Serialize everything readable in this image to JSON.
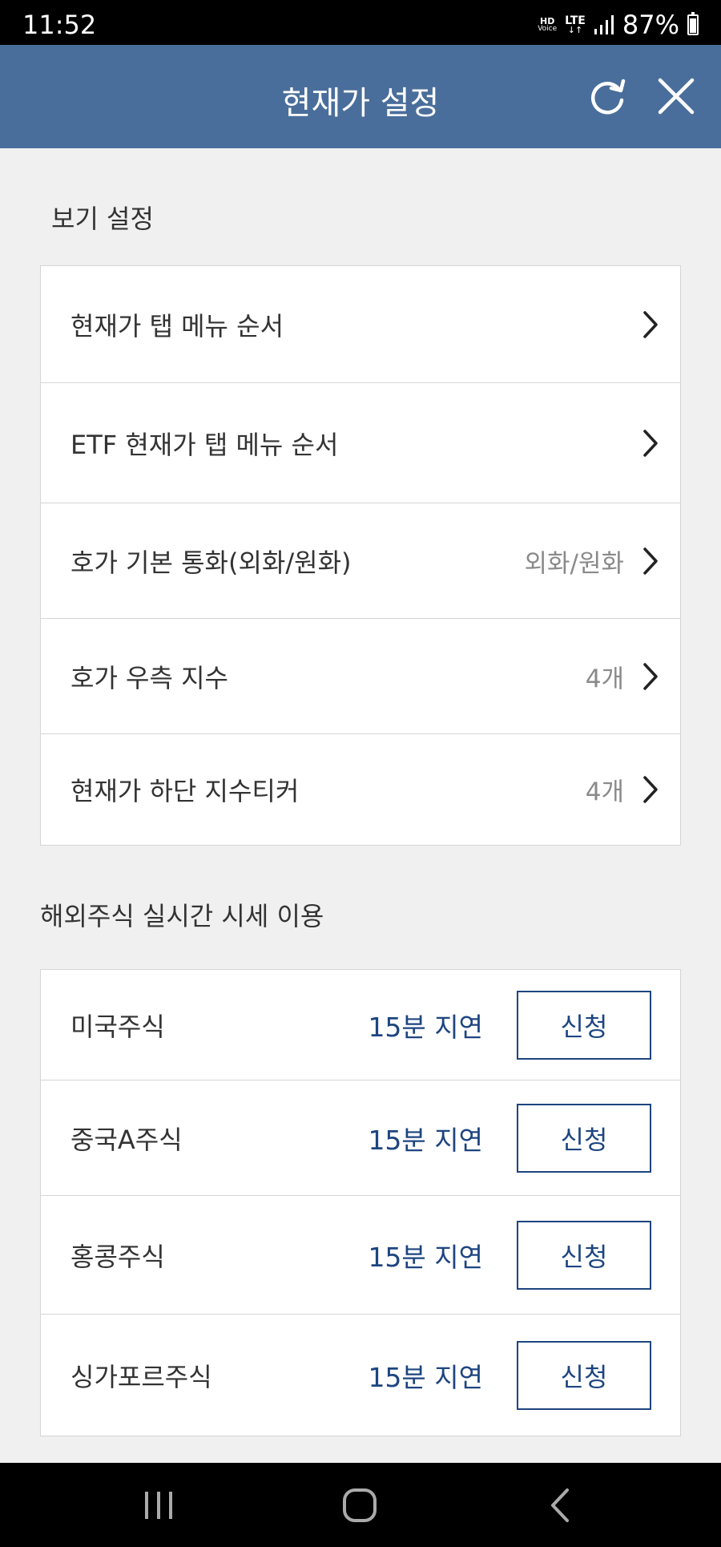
{
  "status": {
    "time": "11:52",
    "hd": "HD",
    "voice": "Voice",
    "lte": "LTE",
    "battery": "87%"
  },
  "header": {
    "title": "현재가 설정"
  },
  "view_section": {
    "title": "보기 설정",
    "items": [
      {
        "label": "현재가 탭 메뉴 순서",
        "value": ""
      },
      {
        "label": "ETF 현재가 탭 메뉴 순서",
        "value": ""
      },
      {
        "label": "호가 기본 통화(외화/원화)",
        "value": "외화/원화"
      },
      {
        "label": "호가 우측 지수",
        "value": "4개"
      },
      {
        "label": "현재가 하단 지수티커",
        "value": "4개"
      }
    ]
  },
  "realtime_section": {
    "title": "해외주식 실시간 시세 이용",
    "items": [
      {
        "label": "미국주식",
        "delay": "15분 지연",
        "button": "신청"
      },
      {
        "label": "중국A주식",
        "delay": "15분 지연",
        "button": "신청"
      },
      {
        "label": "홍콩주식",
        "delay": "15분 지연",
        "button": "신청"
      },
      {
        "label": "싱가포르주식",
        "delay": "15분 지연",
        "button": "신청"
      }
    ]
  },
  "icons": {
    "refresh": "refresh-icon",
    "close": "close-icon",
    "chevron": "chevron-right-icon",
    "nav_recent": "recent-apps-icon",
    "nav_home": "home-icon",
    "nav_back": "back-icon"
  },
  "colors": {
    "header_bg": "#4a6e9b",
    "accent": "#1d4580",
    "page_bg": "#f0f0f0"
  }
}
